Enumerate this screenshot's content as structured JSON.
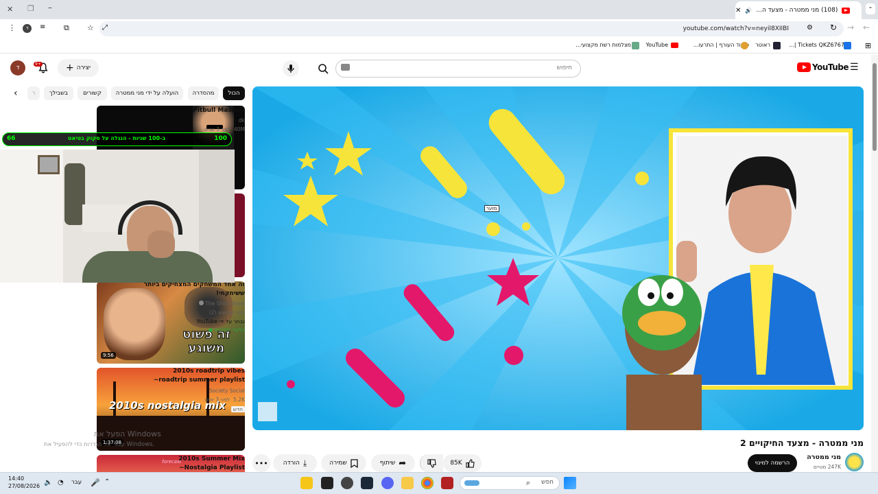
{
  "browser": {
    "tab_title": "(108) מני ממטרה - מצעד ה...",
    "url": "youtube.com/watch?v=neyil8XIIBI",
    "bookmarks": [
      "Tickets QKZ67677 |...",
      "ראוטר",
      "פיקוד העורף | התרעו...",
      "YouTube",
      "מצלמות רשת מקצועי..."
    ]
  },
  "youtube": {
    "logo_text": "YouTube",
    "search_placeholder": "חיפוש",
    "create_label": "יצירה",
    "notifications_count": "9+",
    "avatar_letter": "ד",
    "chips": [
      "הכול",
      "מהסדרה",
      "הועלה על ידי מני ממטרה",
      "קשורים",
      "בשבילך",
      "ר"
    ]
  },
  "recommendations": [
    {
      "title": "Pitbull Mashup",
      "channel": "dk",
      "views": "40M",
      "age": "לפני 3 שנים"
    },
    {
      "title": "זה אחד המשחקים המצחיקים ביותר ששיחקתי!",
      "channel": "The Shon Show",
      "age": "לפני חודשים (2)",
      "chosen_by": "נבחר על ידי YouTube",
      "member_label": "בלעדי למנויים",
      "duration": "9:56",
      "thumb_text": "זה פשוט משוגע"
    },
    {
      "title": "2010s roadtrip vibes ~roadtrip summer playlist",
      "channel": "Society Social",
      "views": "5.2K",
      "age": "לפני 3 ימים",
      "badge": "חדש",
      "duration": "1:37:08",
      "thumb_text": "2010s nostalgia mix"
    },
    {
      "title": "2010s Summer Mix ~Nostalgia Playlist",
      "thumb_text": "forecast"
    }
  ],
  "webcam_hud": {
    "left_value": "66",
    "text": "ב-100 שניות - הנגלה על סקוק בטיאט",
    "right_value": "100"
  },
  "video": {
    "title": "מני ממטרה - מצעד החיקויים 2",
    "channel": "מני ממטרה",
    "subscribers": "247K מנויים",
    "subscribe_label": "הרשמה למינוי",
    "likes": "85K",
    "share_label": "שיתוף",
    "save_label": "שמירה",
    "download_label": "הורדה",
    "overlay_tag": "מזער"
  },
  "windows": {
    "activate_title": "הפעל את Windows",
    "activate_sub": "עבור אל הגדרות כדי להפעיל את Windows.",
    "time": "14:40",
    "date": "27/08/2026",
    "language": "עבר",
    "search_placeholder": "חפש"
  },
  "colors": {
    "youtube_red": "#ff0000",
    "hud_green": "#00ff00",
    "video_bg": "#2bb7ef"
  }
}
